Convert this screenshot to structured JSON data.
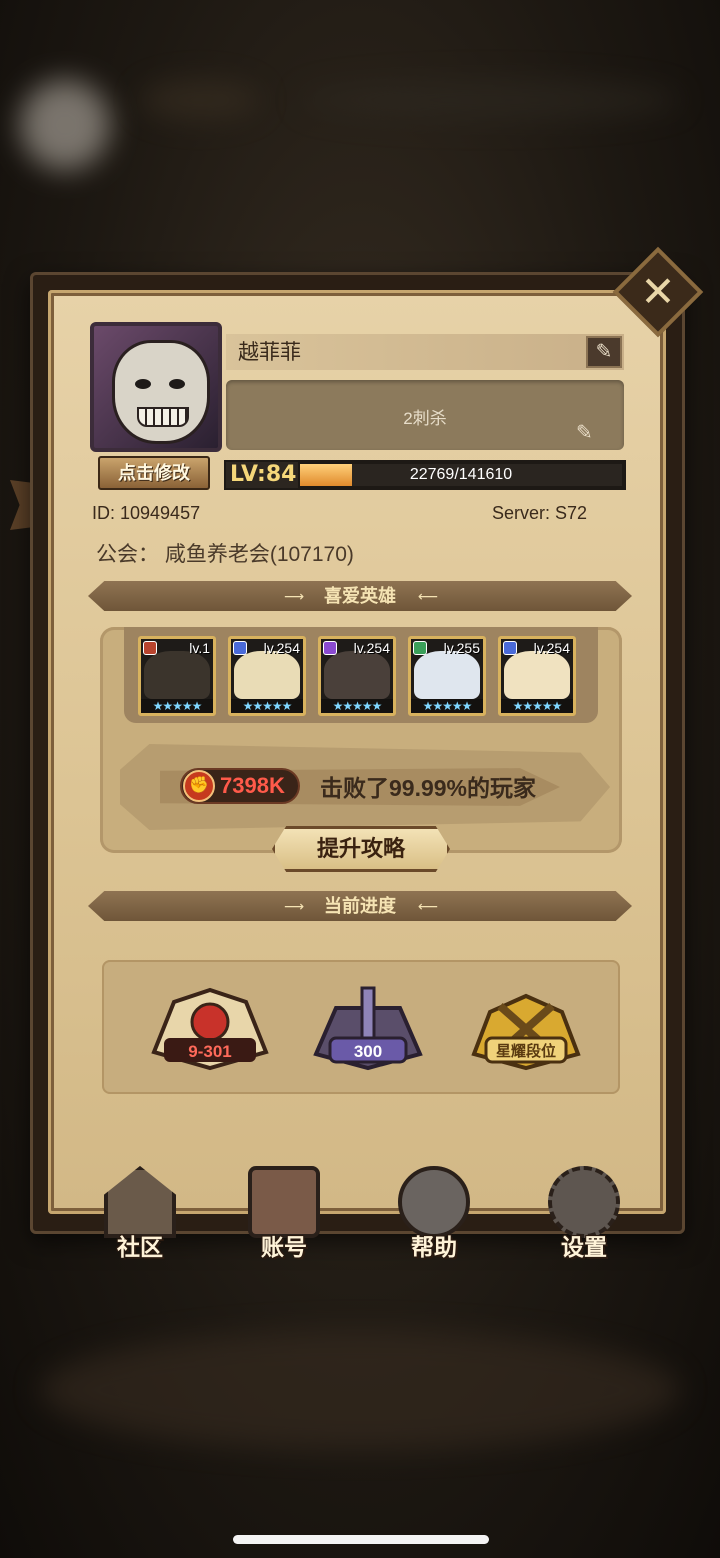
{
  "profile": {
    "name": "越菲菲",
    "signature": "2刺杀",
    "edit_avatar_label": "点击修改",
    "level_label": "LV:84",
    "xp_current": 22769,
    "xp_max": 141610,
    "xp_text": "22769/141610",
    "id_label": "ID:  10949457",
    "server_label": "Server:  S72",
    "guild_label": "公会：  咸鱼养老会(107170)"
  },
  "favorite_heroes": {
    "title": "喜爱英雄",
    "heroes": [
      {
        "level": "lv.1",
        "stars": "★★★★★",
        "element_color": "#b8442e",
        "portrait_color": "#3b342c"
      },
      {
        "level": "lv.254",
        "stars": "★★★★★",
        "element_color": "#4a6ad8",
        "portrait_color": "#e9dcb6"
      },
      {
        "level": "lv.254",
        "stars": "★★★★★",
        "element_color": "#8a4ad0",
        "portrait_color": "#4a403a"
      },
      {
        "level": "lv.255",
        "stars": "★★★★★",
        "element_color": "#3aa05a",
        "portrait_color": "#dfe6ee"
      },
      {
        "level": "lv.254",
        "stars": "★★★★★",
        "element_color": "#4a6ad8",
        "portrait_color": "#f0e2c0"
      }
    ],
    "power_value": "7398K",
    "defeat_text": "击败了99.99%的玩家",
    "strategy_button": "提升攻略"
  },
  "current_progress": {
    "title": "当前进度",
    "items": [
      {
        "label": "9-301",
        "icon": "campaign-book-icon",
        "color": "#c8322a"
      },
      {
        "label": "300",
        "icon": "tower-icon",
        "color": "#6a5aa8"
      },
      {
        "label": "星耀段位",
        "icon": "arena-rank-icon",
        "color": "#d9a930"
      }
    ]
  },
  "nav": {
    "community": "社区",
    "account": "账号",
    "help": "帮助",
    "settings": "设置"
  },
  "colors": {
    "panel_parchment": "#e7d2a8",
    "banner_brown": "#8f7352",
    "xp_fill": "#f0a84a",
    "power_red": "#ff5a4a"
  }
}
